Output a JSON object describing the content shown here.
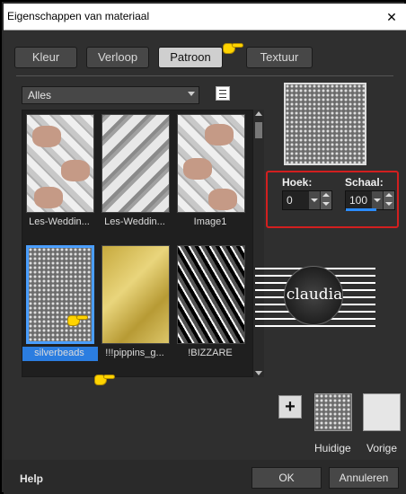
{
  "window": {
    "title": "Eigenschappen van materiaal",
    "close_glyph": "✕"
  },
  "tabs": [
    {
      "label": "Kleur",
      "active": false
    },
    {
      "label": "Verloop",
      "active": false
    },
    {
      "label": "Patroon",
      "active": true
    },
    {
      "label": "Textuur",
      "active": false
    }
  ],
  "filter": {
    "selected": "Alles"
  },
  "patterns": [
    {
      "caption": "Les-Weddin...",
      "selected": false
    },
    {
      "caption": "Les-Weddin...",
      "selected": false
    },
    {
      "caption": "Image1",
      "selected": false
    },
    {
      "caption": "silverbeads",
      "selected": true
    },
    {
      "caption": "!!!pippins_g...",
      "selected": false
    },
    {
      "caption": "!BIZZARE",
      "selected": false
    }
  ],
  "angle": {
    "label": "Hoek:",
    "value": "0"
  },
  "scale": {
    "label": "Schaal:",
    "value": "100"
  },
  "watermark": {
    "text": "claudia"
  },
  "swatches": {
    "current_label": "Huidige",
    "previous_label": "Vorige",
    "previous_color": "#e6e6e6"
  },
  "add_button": {
    "glyph": "+"
  },
  "footer": {
    "help": "Help",
    "ok": "OK",
    "cancel": "Annuleren"
  },
  "accent_color": "#2b8cff",
  "highlight_color": "#d21f1f"
}
